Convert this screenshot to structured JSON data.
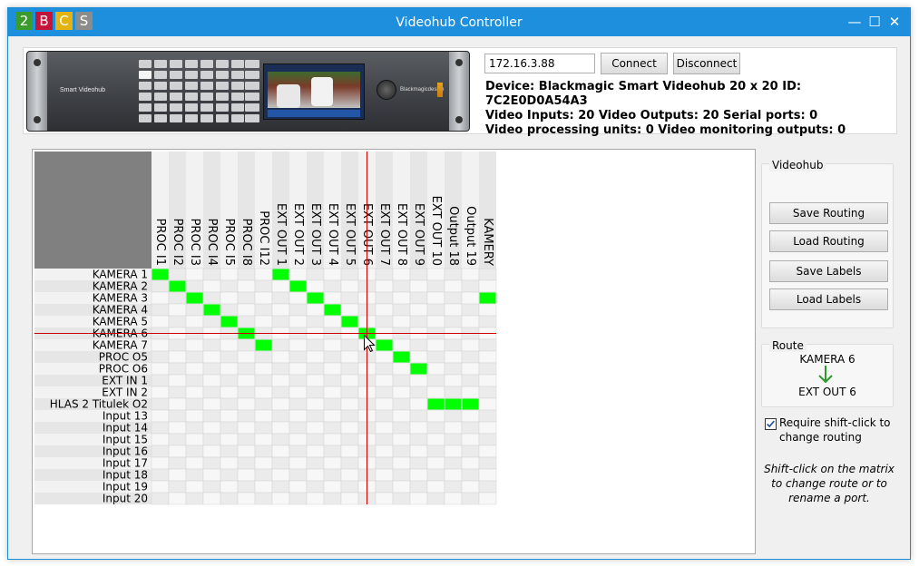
{
  "window": {
    "title": "Videohub Controller",
    "logo_letters": [
      "2",
      "B",
      "C",
      "S"
    ],
    "logo_colors": [
      "#3a9d2b",
      "#c4143a",
      "#e3b312",
      "#8c8c8c"
    ],
    "minimize_label": "—",
    "maximize_label": "☐",
    "close_label": "✕"
  },
  "connection": {
    "ip_value": "172.16.3.88",
    "connect_label": "Connect",
    "disconnect_label": "Disconnect"
  },
  "device_image": {
    "model_label": "Smart Videohub",
    "brand_label": "Blackmagicdesign"
  },
  "device_info": {
    "line1": "Device:  Blackmagic Smart Videohub 20 x 20 ID:  7C2E0D0A54A3",
    "line2": "Video Inputs:  20 Video Outputs:  20 Serial ports:  0",
    "line3": "Video processing units:  0 Video monitoring outputs:  0"
  },
  "matrix": {
    "outputs": [
      "PROC I1",
      "PROC I2",
      "PROC I3",
      "PROC I4",
      "PROC I5",
      "PROC I8",
      "PROC I12",
      "EXT OUT 1",
      "EXT OUT 2",
      "EXT OUT 3",
      "EXT OUT 4",
      "EXT OUT 5",
      "EXT OUT 6",
      "EXT OUT 7",
      "EXT OUT 8",
      "EXT OUT 9",
      "EXT OUT 10",
      "Output 18",
      "Output 19",
      "KAMERY"
    ],
    "inputs": [
      "KAMERA 1",
      "KAMERA 2",
      "KAMERA 3",
      "KAMERA 4",
      "KAMERA 5",
      "KAMERA 6",
      "KAMERA 7",
      "PROC O5",
      "PROC O6",
      "EXT IN 1",
      "EXT IN 2",
      "HLAS 2 Titulek O2",
      "Input 13",
      "Input 14",
      "Input 15",
      "Input 16",
      "Input 17",
      "Input 18",
      "Input 19",
      "Input 20"
    ],
    "routes": [
      [
        0,
        0
      ],
      [
        1,
        1
      ],
      [
        2,
        2
      ],
      [
        3,
        3
      ],
      [
        4,
        4
      ],
      [
        5,
        5
      ],
      [
        6,
        6
      ],
      [
        0,
        7
      ],
      [
        1,
        8
      ],
      [
        2,
        9
      ],
      [
        3,
        10
      ],
      [
        4,
        11
      ],
      [
        5,
        12
      ],
      [
        6,
        13
      ],
      [
        7,
        14
      ],
      [
        8,
        15
      ],
      [
        11,
        16
      ],
      [
        11,
        17
      ],
      [
        11,
        18
      ],
      [
        2,
        19
      ]
    ],
    "hover_input": 5,
    "hover_output": 12,
    "route_color": "#00ff00",
    "crosshair_color": "#cc0000"
  },
  "videohub_group": {
    "title": "Videohub",
    "save_routing": "Save Routing",
    "load_routing": "Load Routing",
    "save_labels": "Save Labels",
    "load_labels": "Load Labels"
  },
  "route_group": {
    "title": "Route",
    "source": "KAMERA 6",
    "destination": "EXT OUT 6"
  },
  "options": {
    "require_shift_checked": true,
    "require_shift_label": "Require shift-click to change routing",
    "hint": "Shift-click on the matrix to change route or to rename a port."
  }
}
